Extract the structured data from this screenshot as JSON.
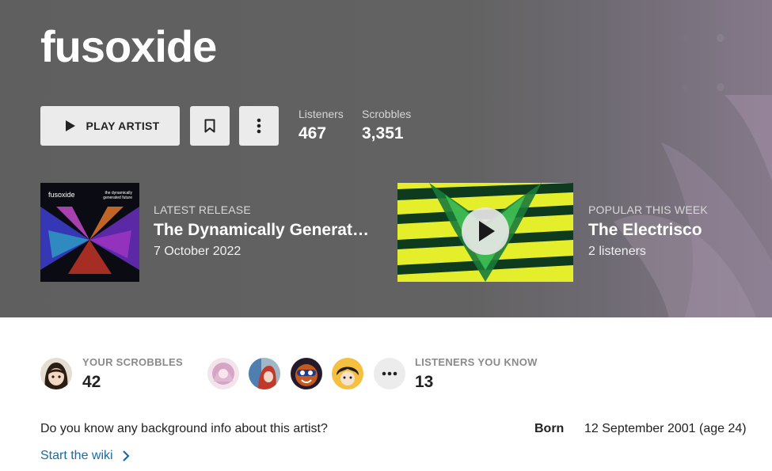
{
  "artist": {
    "name": "fusoxide",
    "play_label": "PLAY ARTIST"
  },
  "stats": {
    "listeners_label": "Listeners",
    "listeners_value": "467",
    "scrobbles_label": "Scrobbles",
    "scrobbles_value": "3,351"
  },
  "latest_release": {
    "tag": "LATEST RELEASE",
    "title": "The Dynamically Generated Future",
    "date": "7 October 2022",
    "cover_text_artist": "fusoxide",
    "cover_text_title": "the dynamically generated future"
  },
  "popular": {
    "tag": "POPULAR THIS WEEK",
    "title": "The Electrisco",
    "listeners": "2 listeners"
  },
  "your_scrobbles": {
    "label": "YOUR SCROBBLES",
    "value": "42"
  },
  "listeners_you_know": {
    "label": "LISTENERS YOU KNOW",
    "value": "13",
    "friends": [
      "friend-1",
      "friend-2",
      "friend-3",
      "friend-4"
    ]
  },
  "wiki": {
    "question": "Do you know any background info about this artist?",
    "link_label": "Start the wiki"
  },
  "born": {
    "label": "Born",
    "value": "12 September 2001 (age 24)"
  },
  "colors": {
    "hero_bg": "#5f5f5f",
    "link": "#1b6aa5",
    "button_bg": "#ebebeb"
  },
  "icons": {
    "play": "play-icon",
    "bookmark": "bookmark-icon",
    "more": "more-vertical-icon",
    "more_friends": "more-horizontal-icon",
    "chevron": "chevron-right-icon"
  }
}
